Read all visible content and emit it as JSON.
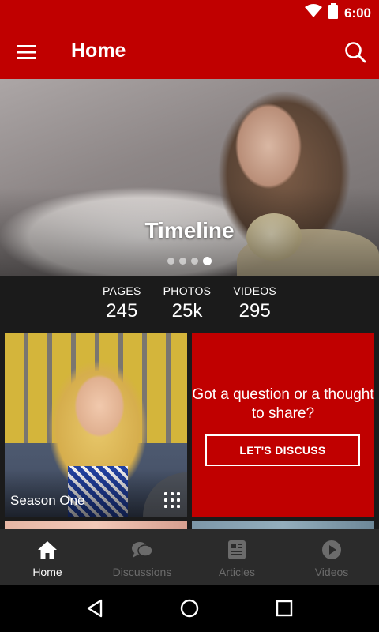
{
  "status_bar": {
    "time": "6:00"
  },
  "app_bar": {
    "title": "Home"
  },
  "hero": {
    "title": "Timeline",
    "slide_count": 4,
    "active_slide": 4
  },
  "stats": [
    {
      "label": "PAGES",
      "value": "245"
    },
    {
      "label": "PHOTOS",
      "value": "25k"
    },
    {
      "label": "VIDEOS",
      "value": "295"
    }
  ],
  "tiles": {
    "left": {
      "label": "Season One"
    },
    "right": {
      "text": "Got a question or a thought to share?",
      "button": "LET'S DISCUSS"
    }
  },
  "bottom_nav": [
    {
      "label": "Home",
      "icon": "home-icon",
      "active": true
    },
    {
      "label": "Discussions",
      "icon": "chat-icon",
      "active": false
    },
    {
      "label": "Articles",
      "icon": "article-icon",
      "active": false
    },
    {
      "label": "Videos",
      "icon": "play-circle-icon",
      "active": false
    }
  ],
  "colors": {
    "brand": "#c00000",
    "nav_bg": "#2b2b2b",
    "inactive": "#6b6b6b"
  }
}
